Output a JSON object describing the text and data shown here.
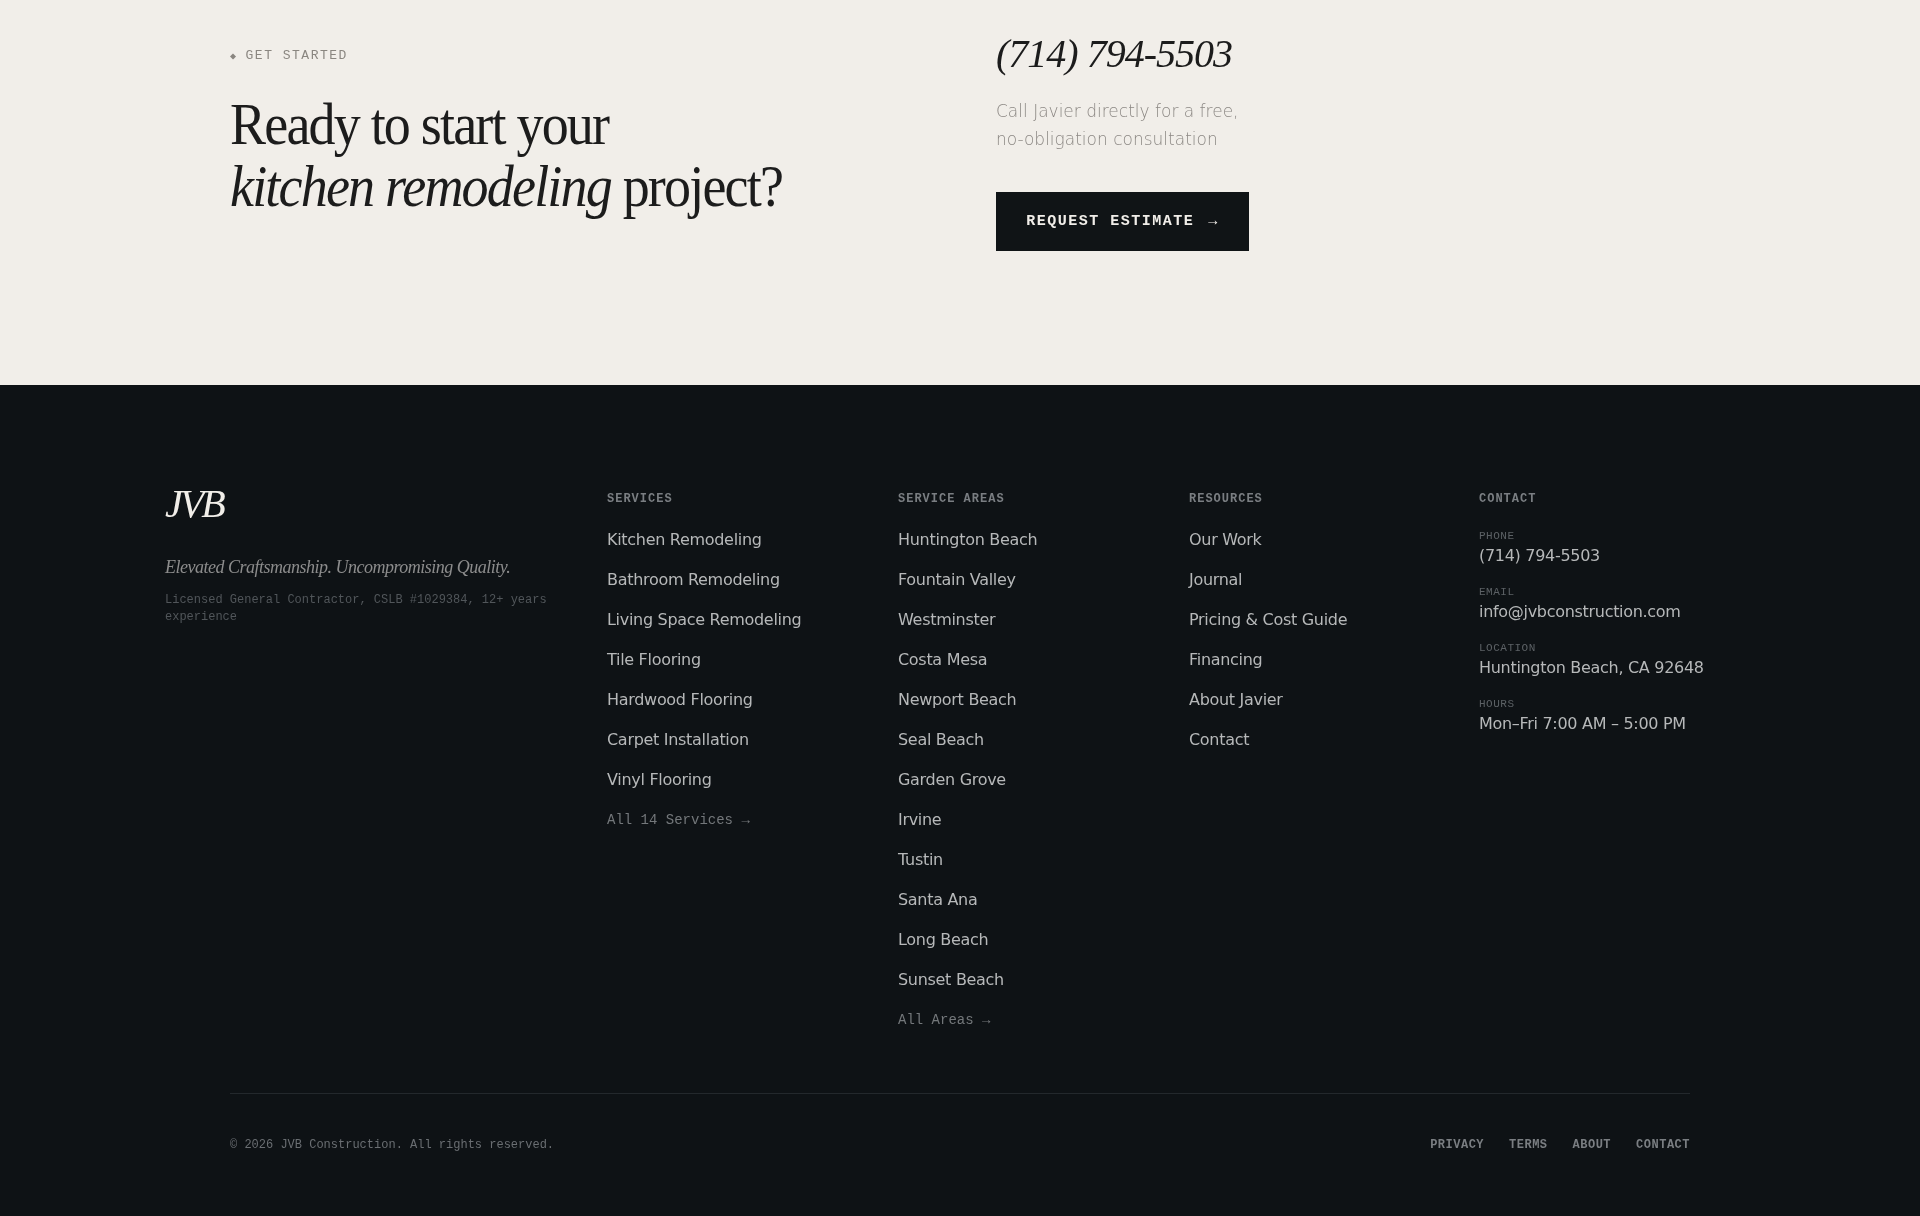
{
  "cta": {
    "eyebrow_icon": "◆",
    "eyebrow": "GET STARTED",
    "heading_lines": [
      "Ready to start your",
      "*kitchen remodeling* project?"
    ],
    "phone": "(714) 794-5503",
    "note_lines": [
      "Call Javier directly for a free,",
      "no-obligation consultation"
    ],
    "button": {
      "label": "REQUEST ESTIMATE",
      "arrow": "→"
    }
  },
  "footer": {
    "logo": "JVB",
    "tagline": "Elevated Craftsmanship. Uncompromising Quality.",
    "license": "Licensed General Contractor, CSLB #1029384, 12+ years experience",
    "columns": [
      {
        "heading": "SERVICES",
        "links": [
          "Kitchen Remodeling",
          "Bathroom Remodeling",
          "Living Space Remodeling",
          "Tile Flooring",
          "Hardwood Flooring",
          "Carpet Installation",
          "Vinyl Flooring"
        ],
        "more": "All 14 Services →"
      },
      {
        "heading": "SERVICE AREAS",
        "links": [
          "Huntington Beach",
          "Fountain Valley",
          "Westminster",
          "Costa Mesa",
          "Newport Beach",
          "Seal Beach",
          "Garden Grove",
          "Irvine",
          "Tustin",
          "Santa Ana",
          "Long Beach",
          "Sunset Beach"
        ],
        "more": "All Areas →"
      },
      {
        "heading": "RESOURCES",
        "links": [
          "Our Work",
          "Journal",
          "Pricing & Cost Guide",
          "Financing",
          "About Javier",
          "Contact"
        ]
      }
    ],
    "contact": {
      "heading": "CONTACT",
      "items": [
        {
          "label": "PHONE",
          "value": "(714) 794-5503"
        },
        {
          "label": "EMAIL",
          "value": "info@jvbconstruction.com"
        },
        {
          "label": "LOCATION",
          "value": "Huntington Beach, CA 92648"
        },
        {
          "label": "HOURS",
          "value": "Mon–Fri 7:00 AM – 5:00 PM"
        }
      ]
    },
    "copyright": "© 2026 JVB Construction. All rights reserved.",
    "legal_links": [
      "PRIVACY",
      "TERMS",
      "ABOUT",
      "CONTACT"
    ]
  }
}
